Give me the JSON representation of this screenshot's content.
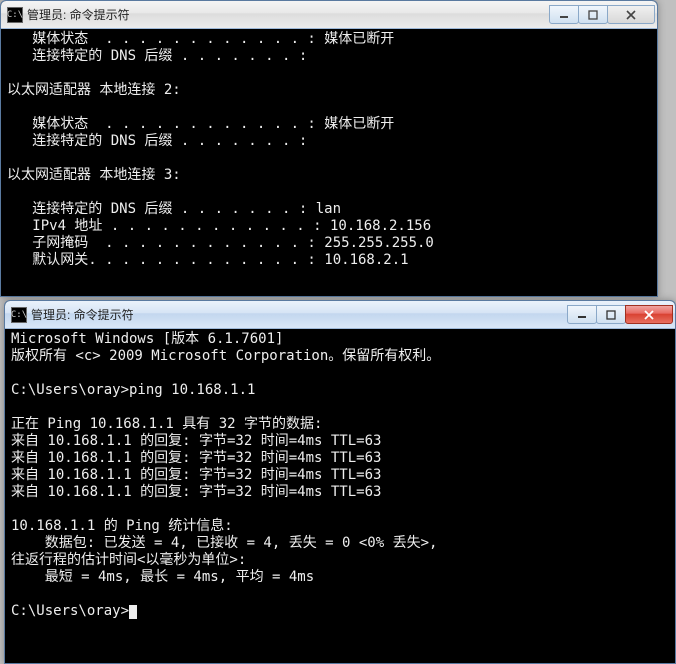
{
  "window1": {
    "title": "管理员: 命令提示符",
    "icon_label": "C:\\",
    "lines": [
      "   媒体状态  . . . . . . . . . . . . : 媒体已断开",
      "   连接特定的 DNS 后缀 . . . . . . . :",
      "",
      "以太网适配器 本地连接 2:",
      "",
      "   媒体状态  . . . . . . . . . . . . : 媒体已断开",
      "   连接特定的 DNS 后缀 . . . . . . . :",
      "",
      "以太网适配器 本地连接 3:",
      "",
      "   连接特定的 DNS 后缀 . . . . . . . : lan",
      "   IPv4 地址 . . . . . . . . . . . . : 10.168.2.156",
      "   子网掩码  . . . . . . . . . . . . : 255.255.255.0",
      "   默认网关. . . . . . . . . . . . . : 10.168.2.1",
      ""
    ]
  },
  "window2": {
    "title": "管理员: 命令提示符",
    "icon_label": "C:\\",
    "lines": [
      "Microsoft Windows [版本 6.1.7601]",
      "版权所有 <c> 2009 Microsoft Corporation。保留所有权利。",
      "",
      "C:\\Users\\oray>ping 10.168.1.1",
      "",
      "正在 Ping 10.168.1.1 具有 32 字节的数据:",
      "来自 10.168.1.1 的回复: 字节=32 时间=4ms TTL=63",
      "来自 10.168.1.1 的回复: 字节=32 时间=4ms TTL=63",
      "来自 10.168.1.1 的回复: 字节=32 时间=4ms TTL=63",
      "来自 10.168.1.1 的回复: 字节=32 时间=4ms TTL=63",
      "",
      "10.168.1.1 的 Ping 统计信息:",
      "    数据包: 已发送 = 4, 已接收 = 4, 丢失 = 0 <0% 丢失>,",
      "往返行程的估计时间<以毫秒为单位>:",
      "    最短 = 4ms, 最长 = 4ms, 平均 = 4ms",
      "",
      "C:\\Users\\oray>"
    ]
  }
}
